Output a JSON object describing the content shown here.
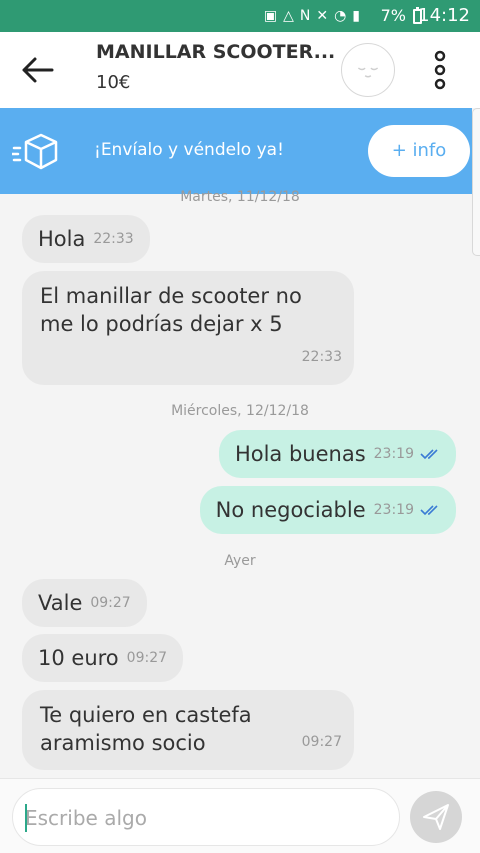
{
  "status": {
    "battery": "7%",
    "time": "14:12",
    "icons": [
      "battery-saver-icon",
      "nfc-icon",
      "n-notification-icon",
      "mute-icon",
      "wifi-icon",
      "signal-icon",
      "battery-icon"
    ]
  },
  "header": {
    "title": "MANILLAR SCOOTER...",
    "price": "10€"
  },
  "banner": {
    "text": "¡Envíalo y véndelo ya!",
    "button": "+ info",
    "bg_color": "#5aaef0"
  },
  "chat": {
    "dates": [
      "Martes, 11/12/18",
      "Miércoles, 12/12/18",
      "Ayer"
    ],
    "messages": [
      {
        "dir": "in",
        "text": "Hola",
        "time": "22:33"
      },
      {
        "dir": "in",
        "lines": [
          "El manillar de scooter no",
          "me lo podrías dejar x 5"
        ],
        "time": "22:33"
      },
      {
        "dir": "out",
        "text": "Hola buenas",
        "time": "23:19",
        "read": true
      },
      {
        "dir": "out",
        "text": "No negociable",
        "time": "23:19",
        "read": true
      },
      {
        "dir": "in",
        "text": "Vale",
        "time": "09:27"
      },
      {
        "dir": "in",
        "text": "10 euro",
        "time": "09:27"
      },
      {
        "dir": "in",
        "lines": [
          "Te quiero en castefa",
          "aramismo socio"
        ],
        "time": "09:27"
      }
    ]
  },
  "composer": {
    "placeholder": "Escribe algo"
  },
  "colors": {
    "status_bar": "#2f9a73",
    "incoming_bubble": "#e8e8e8",
    "outgoing_bubble": "#c7f1e4",
    "read_check": "#3a7bd5"
  }
}
